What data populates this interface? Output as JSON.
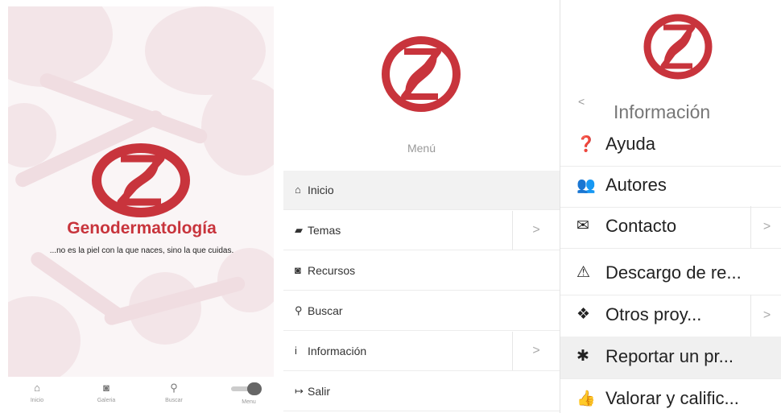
{
  "colors": {
    "brand": "#c8343c",
    "muted": "#999999"
  },
  "splash": {
    "brand_name": "Genodermatología",
    "tagline": "...no es la piel con la que naces, sino la que cuidas.",
    "tabs": [
      {
        "label": "Inicio",
        "icon": "home-icon"
      },
      {
        "label": "Galeria",
        "icon": "camera-icon"
      },
      {
        "label": "Buscar",
        "icon": "search-icon"
      },
      {
        "label": "Menu",
        "icon": "menu-toggle-icon"
      }
    ]
  },
  "menu": {
    "title": "Menú",
    "items": [
      {
        "label": "Inicio",
        "icon": "home-icon",
        "glyph": "⌂",
        "submenu": false,
        "active": true
      },
      {
        "label": "Temas",
        "icon": "book-icon",
        "glyph": "▰",
        "submenu": true,
        "active": false
      },
      {
        "label": "Recursos",
        "icon": "camera-icon",
        "glyph": "◙",
        "submenu": false,
        "active": false
      },
      {
        "label": "Buscar",
        "icon": "search-icon",
        "glyph": "⚲",
        "submenu": false,
        "active": false
      },
      {
        "label": "Información",
        "icon": "info-icon",
        "glyph": "i",
        "submenu": true,
        "active": false
      },
      {
        "label": "Salir",
        "icon": "sign-out-icon",
        "glyph": "↦",
        "submenu": false,
        "active": false
      }
    ]
  },
  "info": {
    "back": "<",
    "title": "Información",
    "items": [
      {
        "label": "Ayuda",
        "icon": "question-circle-icon",
        "glyph": "❓",
        "submenu": false,
        "active": false
      },
      {
        "label": "Autores",
        "icon": "users-icon",
        "glyph": "👥",
        "submenu": false,
        "active": false
      },
      {
        "label": "Contacto",
        "icon": "envelope-open-icon",
        "glyph": "✉",
        "submenu": true,
        "active": false
      },
      {
        "label": "Descargo de re...",
        "icon": "warning-icon",
        "glyph": "⚠",
        "submenu": false,
        "active": false
      },
      {
        "label": "Otros proy...",
        "icon": "cubes-icon",
        "glyph": "❖",
        "submenu": true,
        "active": false
      },
      {
        "label": "Reportar un pr...",
        "icon": "bug-icon",
        "glyph": "✱",
        "submenu": false,
        "active": true
      },
      {
        "label": "Valorar y calific...",
        "icon": "thumbs-up-icon",
        "glyph": "👍",
        "submenu": false,
        "active": false
      }
    ]
  }
}
